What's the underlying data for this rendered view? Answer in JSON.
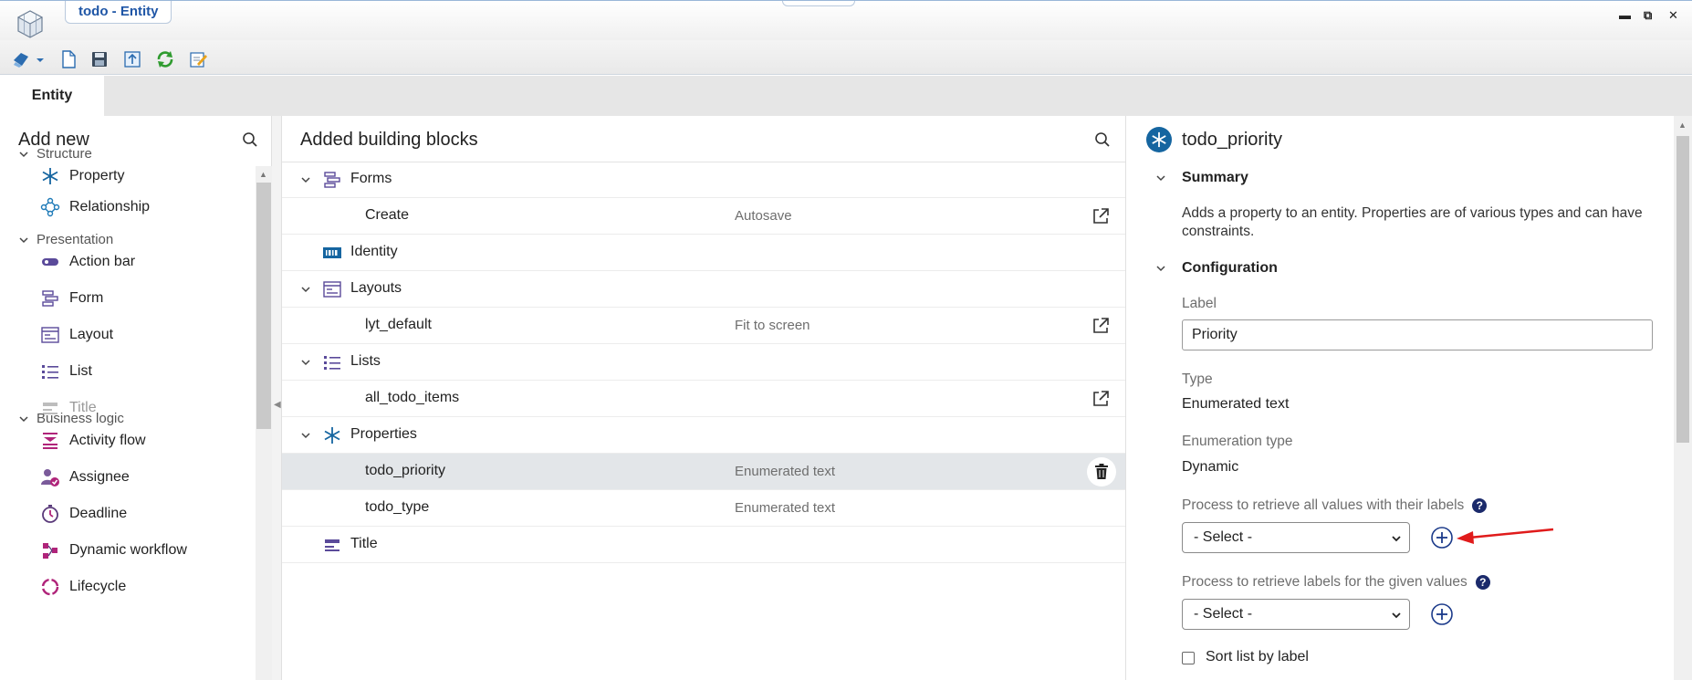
{
  "window": {
    "title": "todo - Entity",
    "controls": {
      "minimize": "▬",
      "restore": "⧉",
      "close": "✕"
    }
  },
  "toolbar": {
    "icons": [
      "deploy-icon",
      "dropdown-icon",
      "new-document-icon",
      "save-icon",
      "publish-icon",
      "refresh-icon",
      "edit-icon"
    ]
  },
  "tabs": [
    {
      "label": "Entity",
      "active": true
    }
  ],
  "left_panel": {
    "title": "Add new",
    "sections": [
      {
        "label": "Structure",
        "items": [
          {
            "label": "Property",
            "icon": "asterisk-icon"
          },
          {
            "label": "Relationship",
            "icon": "relationship-icon"
          }
        ]
      },
      {
        "label": "Presentation",
        "items": [
          {
            "label": "Action bar",
            "icon": "action-bar-icon"
          },
          {
            "label": "Form",
            "icon": "form-icon"
          },
          {
            "label": "Layout",
            "icon": "layout-icon"
          },
          {
            "label": "List",
            "icon": "list-icon"
          },
          {
            "label": "Title",
            "icon": "title-icon",
            "disabled": true
          }
        ]
      },
      {
        "label": "Business logic",
        "items": [
          {
            "label": "Activity flow",
            "icon": "activity-flow-icon"
          },
          {
            "label": "Assignee",
            "icon": "assignee-icon"
          },
          {
            "label": "Deadline",
            "icon": "deadline-icon"
          },
          {
            "label": "Dynamic workflow",
            "icon": "dynamic-workflow-icon"
          },
          {
            "label": "Lifecycle",
            "icon": "lifecycle-icon"
          }
        ]
      }
    ]
  },
  "middle_panel": {
    "title": "Added building blocks",
    "rows": [
      {
        "kind": "group",
        "label": "Forms",
        "icon": "form-icon",
        "expanded": true
      },
      {
        "kind": "child",
        "label": "Create",
        "description": "Autosave",
        "action": "open-external-icon"
      },
      {
        "kind": "group",
        "label": "Identity",
        "icon": "identity-icon",
        "expanded": null
      },
      {
        "kind": "group",
        "label": "Layouts",
        "icon": "layout-icon",
        "expanded": true
      },
      {
        "kind": "child",
        "label": "lyt_default",
        "description": "Fit to screen",
        "action": "open-external-icon"
      },
      {
        "kind": "group",
        "label": "Lists",
        "icon": "list-icon",
        "expanded": true
      },
      {
        "kind": "child",
        "label": "all_todo_items",
        "description": "",
        "action": "open-external-icon"
      },
      {
        "kind": "group",
        "label": "Properties",
        "icon": "asterisk-icon",
        "expanded": true
      },
      {
        "kind": "child",
        "label": "todo_priority",
        "description": "Enumerated text",
        "action": "trash-icon",
        "selected": true
      },
      {
        "kind": "child",
        "label": "todo_type",
        "description": "Enumerated text",
        "action": ""
      },
      {
        "kind": "group",
        "label": "Title",
        "icon": "title-icon",
        "expanded": null
      }
    ]
  },
  "right_panel": {
    "title": "todo_priority",
    "summary": {
      "heading": "Summary",
      "text": "Adds a property to an entity. Properties are of various types and can have constraints."
    },
    "configuration": {
      "heading": "Configuration",
      "label_caption": "Label",
      "label_value": "Priority",
      "type_caption": "Type",
      "type_value": "Enumerated text",
      "enum_caption": "Enumeration type",
      "enum_value": "Dynamic",
      "process_all_caption": "Process to retrieve all values with their labels",
      "process_all_value": "- Select -",
      "process_labels_caption": "Process to retrieve labels for the given values",
      "process_labels_value": "- Select -",
      "sort_label": "Sort list by label",
      "sort_checked": false,
      "help_glyph": "?"
    }
  },
  "colors": {
    "accent_blue": "#1565a0",
    "purple_icon": "#6a4c9c",
    "magenta_icon": "#b0247a",
    "annotation_arrow": "#e01b1b"
  }
}
